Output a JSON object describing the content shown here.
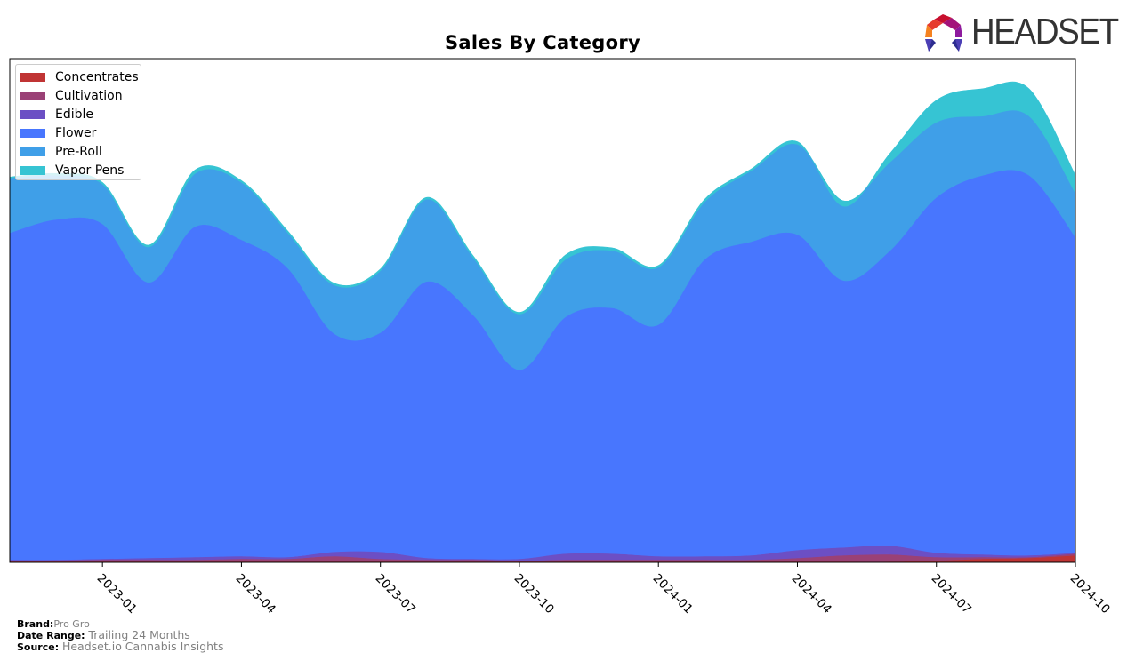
{
  "logo": {
    "text": "HEADSET",
    "icon": "headset-logo-icon"
  },
  "footer": {
    "brand_label": "Brand:",
    "brand_value": "Pro Gro",
    "date_range_label": "Date Range:",
    "date_range_value": "Trailing 24 Months",
    "source_label": "Source:",
    "source_value": "Headset.io Cannabis Insights"
  },
  "chart_data": {
    "type": "area",
    "stacked": true,
    "title": "Sales By Category",
    "xlabel": "",
    "ylabel": "",
    "y_axis_visible": false,
    "ylim": [
      0,
      570
    ],
    "units": "relative (no y-axis shown)",
    "x": [
      "2022-11",
      "2022-12",
      "2023-01",
      "2023-02",
      "2023-03",
      "2023-04",
      "2023-05",
      "2023-06",
      "2023-07",
      "2023-08",
      "2023-09",
      "2023-10",
      "2023-11",
      "2023-12",
      "2024-01",
      "2024-02",
      "2024-03",
      "2024-04",
      "2024-05",
      "2024-06",
      "2024-07",
      "2024-08",
      "2024-09",
      "2024-10"
    ],
    "xtick_labels": [
      "2023-01",
      "2023-04",
      "2023-07",
      "2023-10",
      "2024-01",
      "2024-04",
      "2024-07",
      "2024-10"
    ],
    "legend": {
      "placement": "top-left",
      "entries": [
        "Concentrates",
        "Cultivation",
        "Edible",
        "Flower",
        "Pre-Roll",
        "Vapor Pens"
      ]
    },
    "grid": false,
    "series": [
      {
        "name": "Concentrates",
        "color": "#c03434",
        "values": [
          1,
          1,
          1,
          1,
          1,
          1,
          1,
          1,
          1,
          1,
          1,
          1,
          1,
          1,
          1,
          1,
          1,
          1,
          1,
          1,
          2,
          4,
          5,
          8
        ]
      },
      {
        "name": "Cultivation",
        "color": "#9a4176",
        "values": [
          1,
          1,
          2,
          2,
          2,
          3,
          3,
          6,
          3,
          2,
          2,
          1,
          2,
          2,
          2,
          2,
          2,
          4,
          7,
          8,
          4,
          2,
          1,
          2
        ]
      },
      {
        "name": "Edible",
        "color": "#6c4fc4",
        "values": [
          1,
          1,
          1,
          2,
          3,
          3,
          2,
          5,
          8,
          2,
          1,
          2,
          7,
          7,
          4,
          4,
          5,
          9,
          9,
          10,
          5,
          3,
          2,
          1
        ]
      },
      {
        "name": "Flower",
        "color": "#4876fe",
        "values": [
          370,
          385,
          379,
          312,
          374,
          358,
          327,
          247,
          248,
          313,
          276,
          214,
          268,
          278,
          262,
          336,
          355,
          357,
          302,
          334,
          402,
          429,
          430,
          357
        ]
      },
      {
        "name": "Pre-Roll",
        "color": "#3f9fe8",
        "values": [
          62,
          50,
          45,
          40,
          60,
          65,
          40,
          55,
          70,
          93,
          65,
          63,
          65,
          65,
          65,
          65,
          80,
          102,
          90,
          100,
          85,
          67,
          67,
          50
        ]
      },
      {
        "name": "Vapor Pens",
        "color": "#36c4d3",
        "values": [
          1,
          2,
          2,
          2,
          4,
          2,
          2,
          2,
          2,
          2,
          2,
          2,
          5,
          3,
          2,
          3,
          2,
          3,
          -6,
          10,
          25,
          31,
          31,
          20
        ]
      }
    ]
  }
}
